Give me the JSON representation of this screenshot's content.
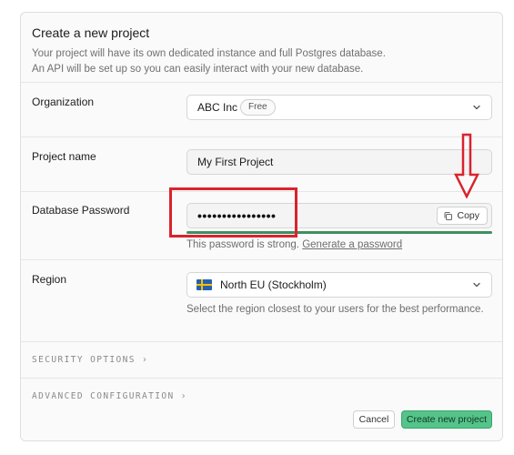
{
  "header": {
    "title": "Create a new project",
    "desc_line1": "Your project will have its own dedicated instance and full Postgres database.",
    "desc_line2": "An API will be set up so you can easily interact with your new database."
  },
  "organization": {
    "label": "Organization",
    "value": "ABC Inc",
    "plan_badge": "Free",
    "icon": "chevron-down-icon"
  },
  "project_name": {
    "label": "Project name",
    "value": "My First Project"
  },
  "password": {
    "label": "Database Password",
    "value_masked": "••••••••••••••••",
    "copy_label": "Copy",
    "strength_text": "This password is strong.",
    "generate_link": "Generate a password",
    "strength_color": "#3f8f5f"
  },
  "region": {
    "label": "Region",
    "value": "North EU (Stockholm)",
    "help": "Select the region closest to your users for the best performance.",
    "flag_icon": "sweden-flag-icon"
  },
  "collapsibles": {
    "security": "SECURITY OPTIONS ›",
    "advanced": "ADVANCED CONFIGURATION ›"
  },
  "footer": {
    "cancel_label": "Cancel",
    "create_label": "Create new project"
  },
  "colors": {
    "accent": "#55c38a",
    "annotation": "#d9232d"
  }
}
